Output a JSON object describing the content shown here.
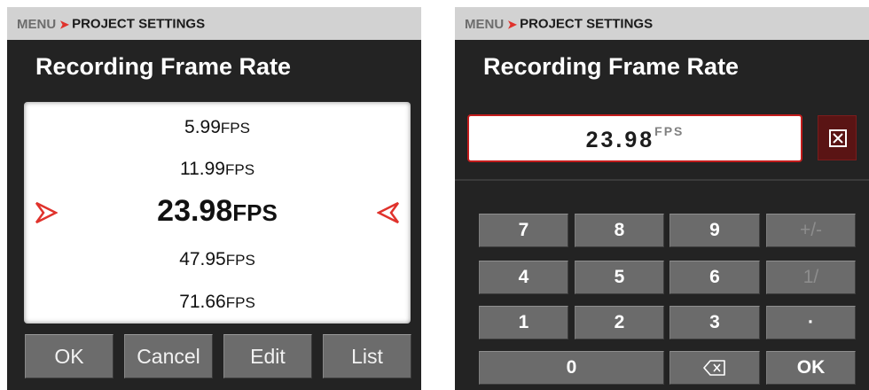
{
  "left": {
    "breadcrumb": {
      "menu": "MENU",
      "separator": ">",
      "current": "PROJECT SETTINGS"
    },
    "title": "Recording Frame Rate",
    "frame_rates": [
      {
        "value": "5.99",
        "unit": "FPS",
        "selected": false
      },
      {
        "value": "11.99",
        "unit": "FPS",
        "selected": false
      },
      {
        "value": "23.98",
        "unit": "FPS",
        "selected": true
      },
      {
        "value": "47.95",
        "unit": "FPS",
        "selected": false
      },
      {
        "value": "71.66",
        "unit": "FPS",
        "selected": false
      }
    ],
    "marker_color": "#e0322c",
    "buttons": {
      "ok": "OK",
      "cancel": "Cancel",
      "edit": "Edit",
      "list": "List"
    }
  },
  "right": {
    "breadcrumb": {
      "menu": "MENU",
      "separator": ">",
      "current": "PROJECT SETTINGS"
    },
    "title": "Recording Frame Rate",
    "input": {
      "value": "23.98",
      "unit": "FPS"
    },
    "clear_icon": "clear-box-icon",
    "keys": {
      "k7": "7",
      "k8": "8",
      "k9": "9",
      "plusminus": "+/-",
      "k4": "4",
      "k5": "5",
      "k6": "6",
      "reciprocal": "1/",
      "k1": "1",
      "k2": "2",
      "k3": "3",
      "decimal": "·",
      "k0": "0",
      "ok": "OK"
    },
    "backspace_icon": "backspace-icon",
    "accent": "#c31c1c"
  }
}
